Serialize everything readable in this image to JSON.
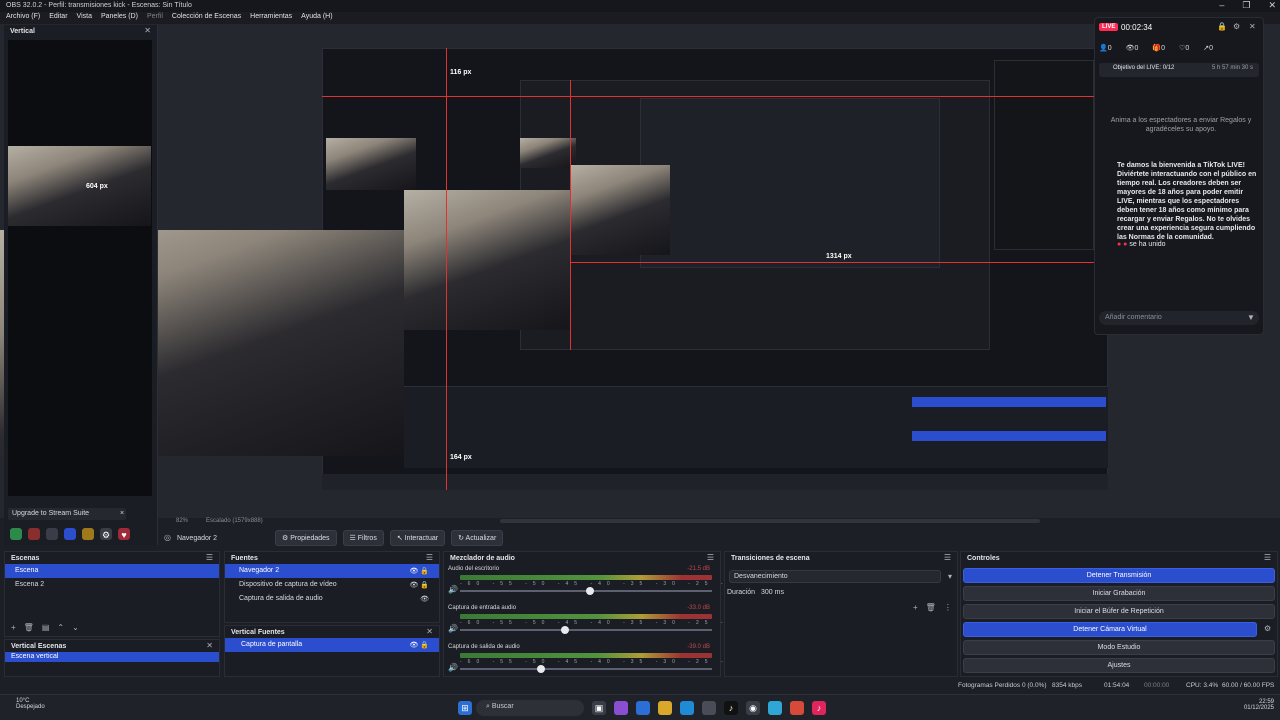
{
  "window": {
    "title": "OBS 32.0.2 - Perfil: transmisiones kick - Escenas: Sin Título",
    "controls": [
      "–",
      "❐",
      "✕"
    ]
  },
  "menu": [
    "Archivo (F)",
    "Editar",
    "Vista",
    "Paneles (D)",
    "Perfil",
    "Colección de Escenas",
    "Herramientas",
    "Ayuda (H)"
  ],
  "vertical_dock": {
    "title": "Vertical",
    "label_604": "604 px",
    "upgrade": "Upgrade to Stream Suite",
    "upgrade_close": "×"
  },
  "preview": {
    "label_116": "116 px",
    "label_1314": "1314 px",
    "label_164": "164 px",
    "zoom_text": "82%",
    "scale_text": "Escalado (1579x888)"
  },
  "live_panel": {
    "badge": "LIVE",
    "time": "00:02:34",
    "stats": [
      "0",
      "0",
      "0",
      "0",
      "0"
    ],
    "goal_label": "Objetivo del LIVE: 0/12",
    "goal_time": "5 h 57 min 30 s",
    "gift_prompt": "Anima a los espectadores a enviar Regalos y agradéceles su apoyo.",
    "welcome": "Te damos la bienvenida a TikTok LIVE! Diviértete interactuando con el público en tiempo real. Los creadores deben ser mayores de 18 años para poder emitir LIVE, mientras que los espectadores deben tener 18 años como mínimo para recargar y enviar Regalos. No te olvides crear una experiencia segura cumpliendo las Normas de la comunidad.",
    "joined": "se ha unido",
    "comment_placeholder": "Añadir comentario"
  },
  "source_toolbar": {
    "source": "Navegador 2",
    "properties": "Propiedades",
    "filters": "Filtros",
    "interact": "Interactuar",
    "refresh": "Actualizar"
  },
  "scenes": {
    "title": "Escenas",
    "items": [
      "Escena",
      "Escena 2"
    ]
  },
  "vertical_scenes": {
    "title": "Vertical Escenas",
    "items": [
      "Escena vertical"
    ]
  },
  "sources": {
    "title": "Fuentes",
    "items": [
      "Navegador 2",
      "Dispositivo de captura de vídeo",
      "Captura de salida de audio"
    ]
  },
  "vertical_sources": {
    "title": "Vertical Fuentes",
    "items": [
      "Captura de pantalla"
    ]
  },
  "mixer": {
    "title": "Mezclador de audio",
    "scale": "-60 -55 -50 -45 -40 -35 -30 -25 -20 -15 -10 -5 0",
    "channels": [
      {
        "name": "Audio del escritorio",
        "db": "-21.5 dB",
        "level": 0.9
      },
      {
        "name": "Captura de entrada audio",
        "db": "-33.0 dB",
        "level": 0.72
      },
      {
        "name": "Captura de salida de audio",
        "db": "-39.0 dB",
        "level": 0.55
      }
    ]
  },
  "transitions": {
    "title": "Transiciones de escena",
    "selected": "Desvanecimiento",
    "duration_label": "Duración",
    "duration_value": "300 ms"
  },
  "controls": {
    "title": "Controles",
    "buttons": [
      "Detener Transmisión",
      "Iniciar Grabación",
      "Iniciar el Búfer de Repetición",
      "Detener Cámara Virtual",
      "Modo Estudio",
      "Ajustes"
    ]
  },
  "status": {
    "dropped": "Fotogramas Perdidos 0 (0.0%)",
    "bitrate": "8354 kbps",
    "stream_time": "01:54:04",
    "rec_time": "00:00:00",
    "cpu": "CPU: 3.4%",
    "fps": "60.00 / 60.00 FPS"
  },
  "taskbar": {
    "weather_temp": "10°C",
    "weather_desc": "Despejado",
    "search": "Buscar",
    "time": "22:59",
    "date": "01/12/2025"
  },
  "colors": {
    "accent": "#2b4ecf",
    "live": "#fe2c55",
    "guide": "#e23131"
  }
}
